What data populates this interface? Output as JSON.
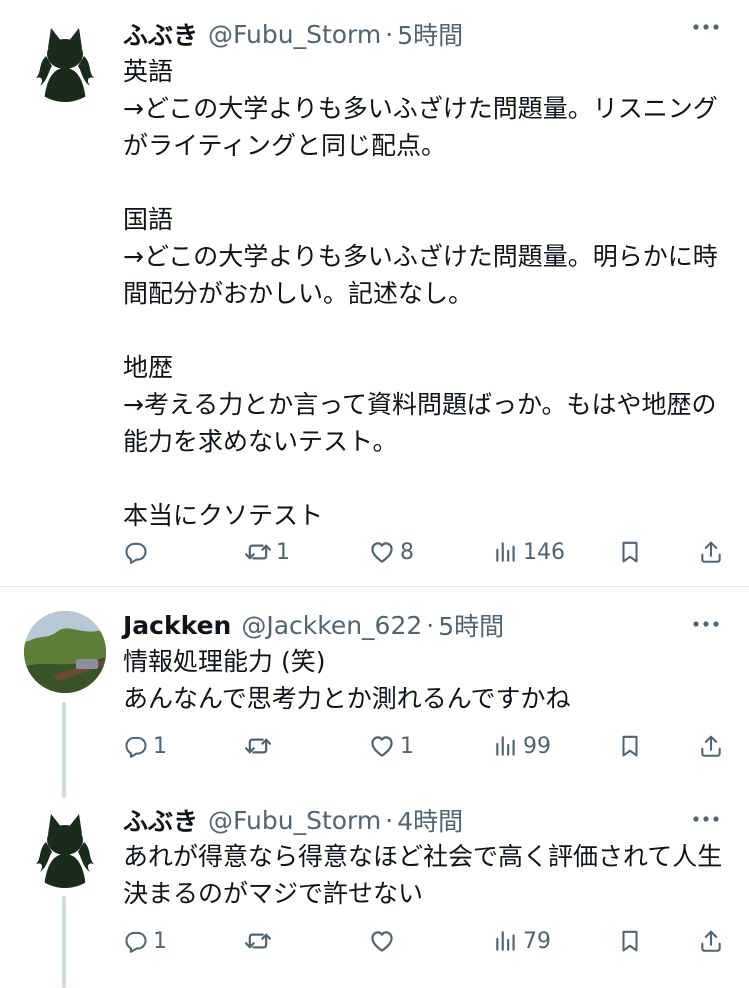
{
  "tweets": [
    {
      "name": "ふぶき",
      "handle": "@Fubu_Storm",
      "separator": "·",
      "time": "5時間",
      "text": "英語\n→どこの大学よりも多いふざけた問題量。リスニングがライティングと同じ配点。\n\n国語\n→どこの大学よりも多いふざけた問題量。明らかに時間配分がおかしい。記述なし。\n\n地歴\n→考える力とか言って資料問題ばっか。もはや地歴の能力を求めないテスト。\n\n本当にクソテスト",
      "replies": "",
      "retweets": "1",
      "likes": "8",
      "views": "146"
    },
    {
      "name": "Jackken",
      "handle": "@Jackken_622",
      "separator": "·",
      "time": "5時間",
      "text": "情報処理能力 (笑)\nあんなんで思考力とか測れるんですかね",
      "replies": "1",
      "retweets": "",
      "likes": "1",
      "views": "99"
    },
    {
      "name": "ふぶき",
      "handle": "@Fubu_Storm",
      "separator": "·",
      "time": "4時間",
      "text": "あれが得意なら得意なほど社会で高く評価されて人生決まるのがマジで許せない",
      "replies": "1",
      "retweets": "",
      "likes": "",
      "views": "79"
    }
  ],
  "icons": {
    "more": "more-horizontal-icon",
    "reply": "reply-icon",
    "retweet": "retweet-icon",
    "like": "heart-icon",
    "views": "views-chart-icon",
    "bookmark": "bookmark-icon",
    "share": "share-icon"
  },
  "colors": {
    "text": "#0f1419",
    "secondary": "#536471",
    "divider": "#e7e9ec",
    "thread_line": "#cfd9de"
  }
}
